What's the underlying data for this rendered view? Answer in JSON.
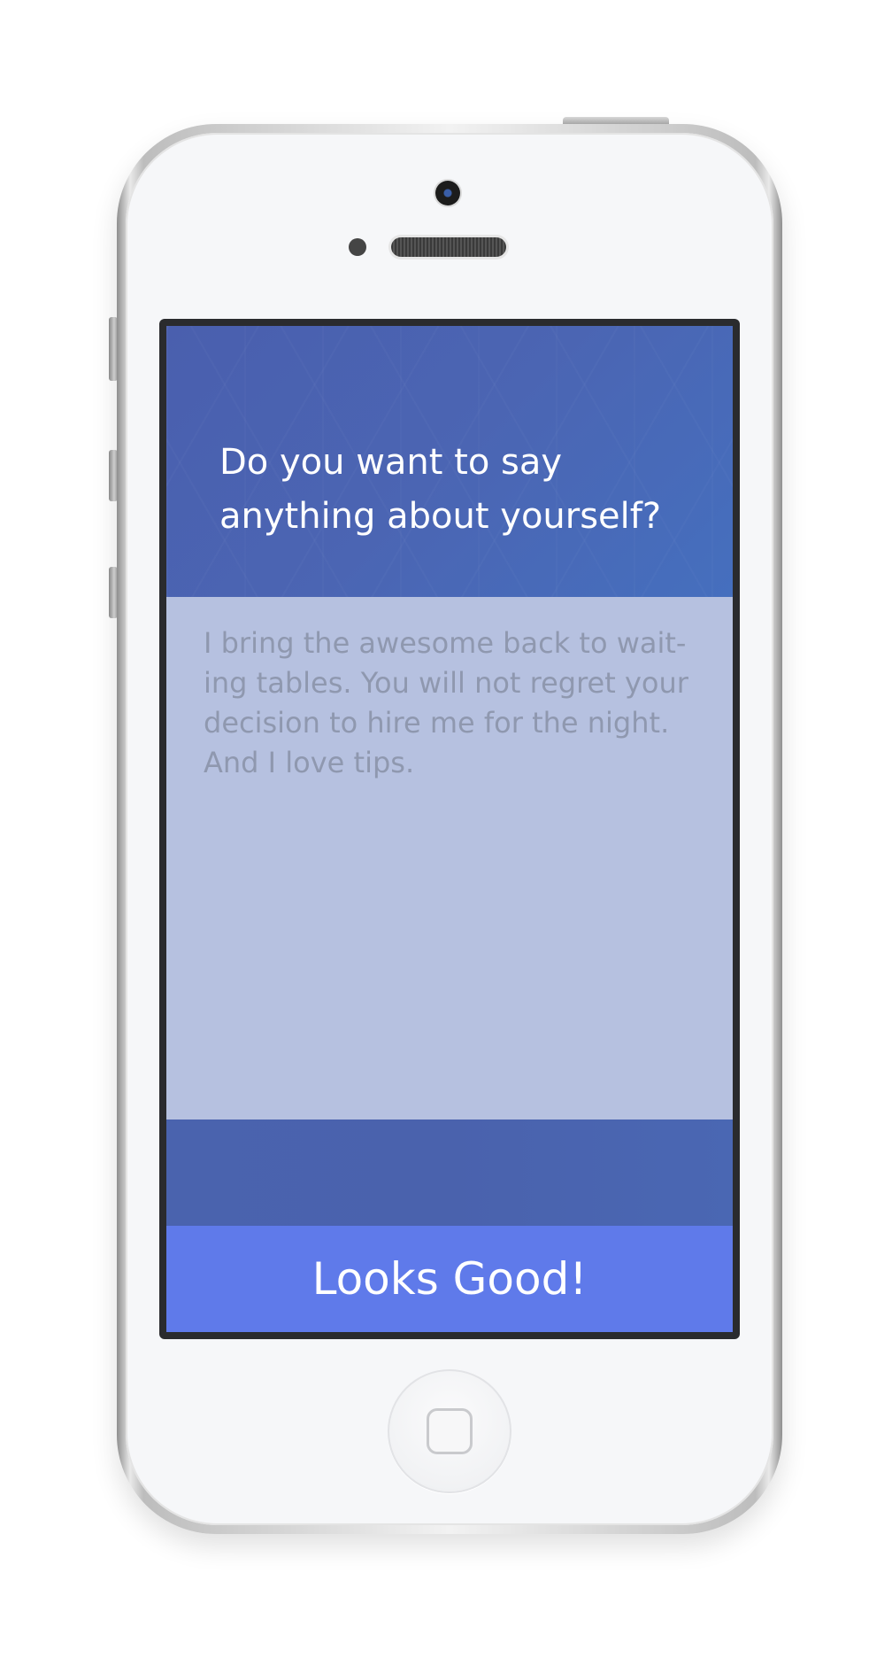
{
  "screen": {
    "question": "Do you want to say anything about yourself?",
    "about_text": "I bring the awesome back to wait-ing tables. You will not regret your decision to hire me for the night. And I love tips.",
    "submit_label": "Looks Good!"
  },
  "colors": {
    "header": "#4b62ae",
    "textarea_background": "#b6c1e0",
    "text_color": "#8f98af",
    "button": "#5f7aea"
  }
}
